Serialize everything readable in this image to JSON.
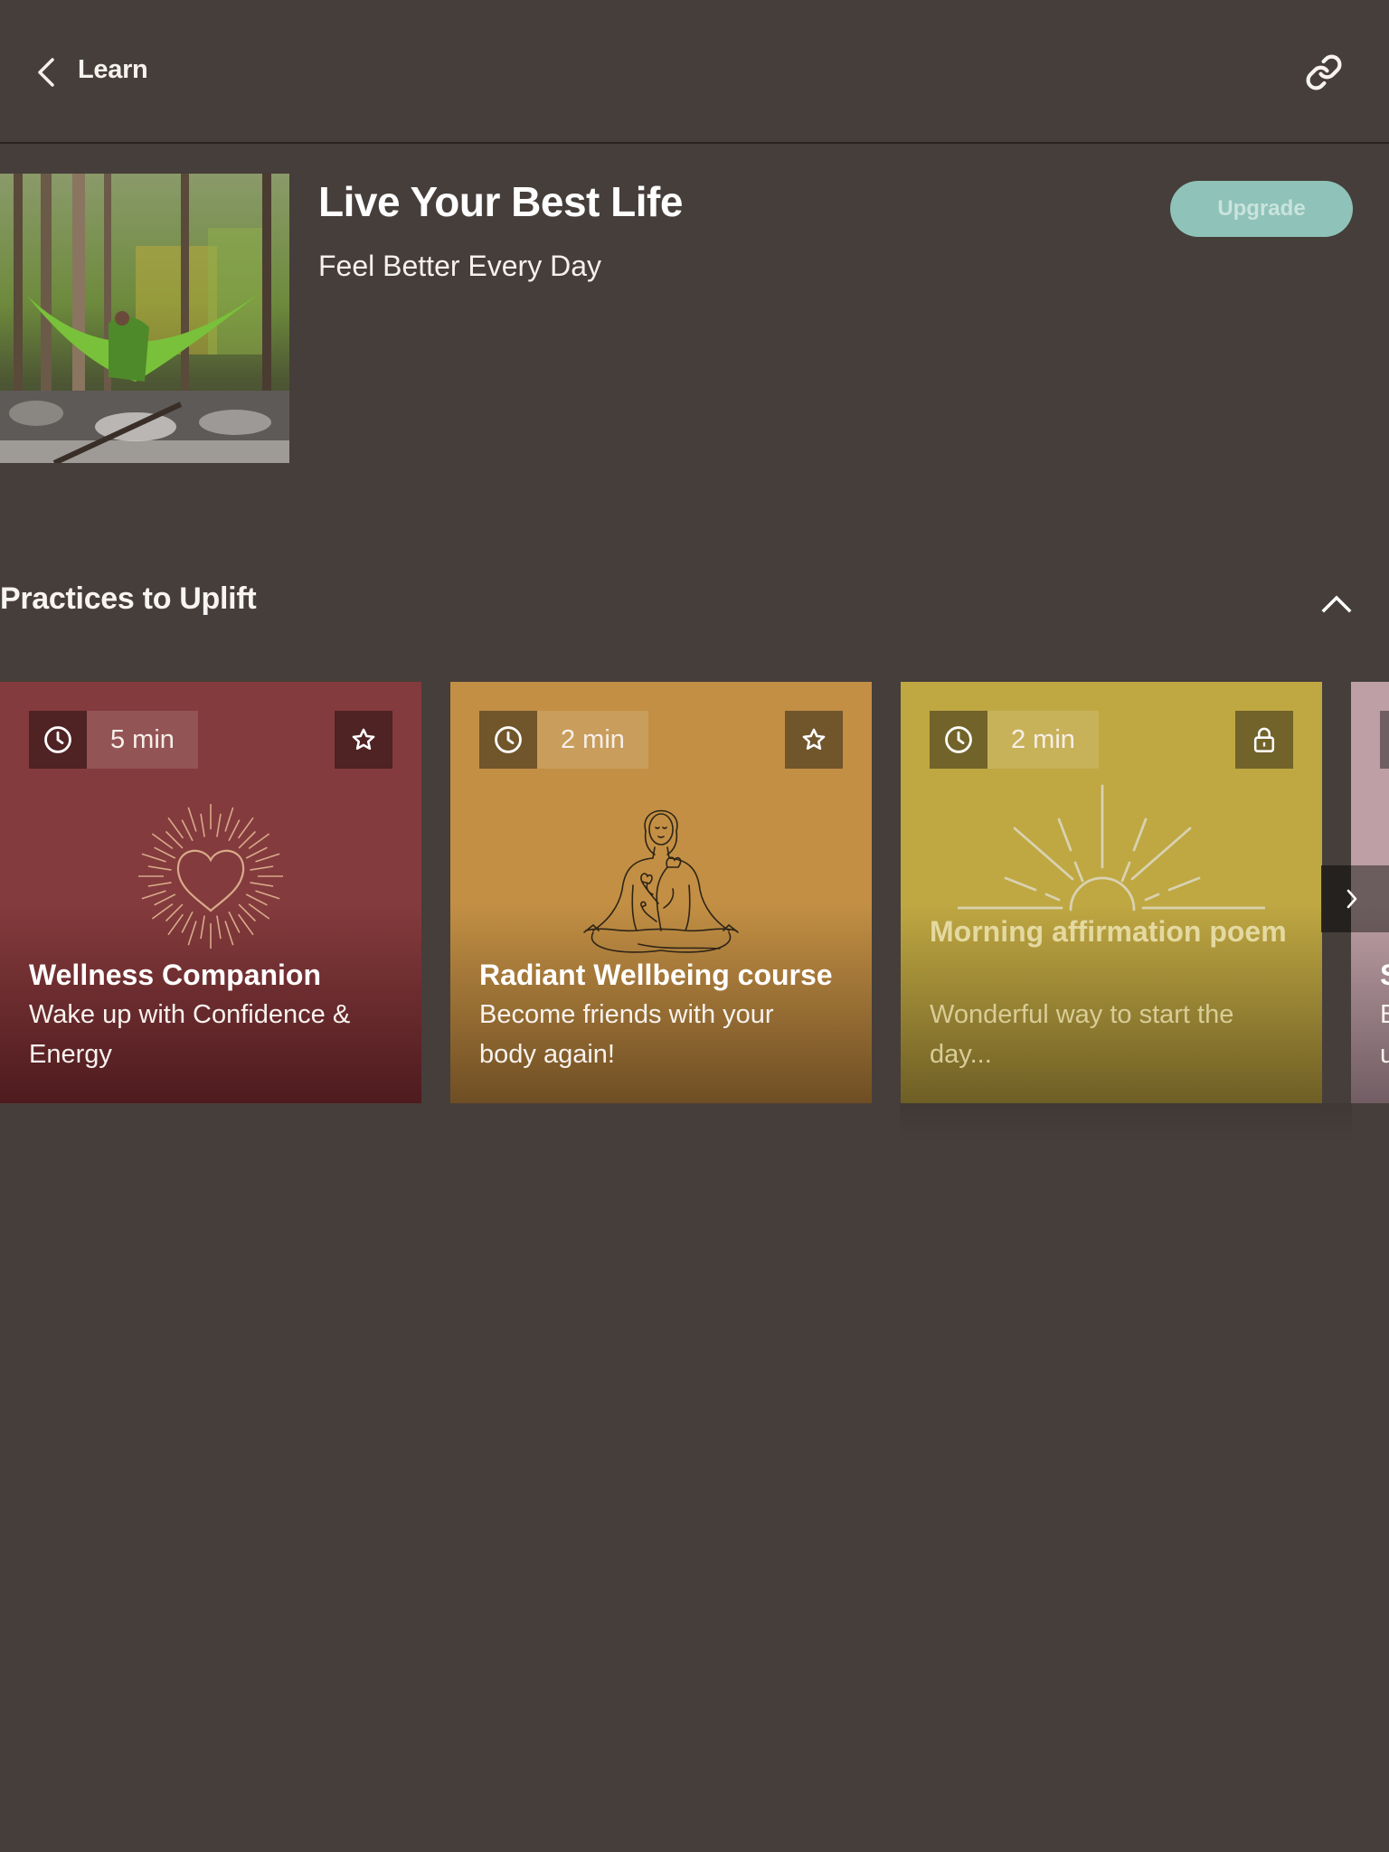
{
  "topbar": {
    "back_icon": "chevron-left-icon",
    "title": "Learn",
    "share_icon": "link-icon"
  },
  "hero": {
    "image_alt": "Person relaxing in a green hammock over a forest stream",
    "title": "Live Your Best Life",
    "subtitle": "Feel Better Every Day",
    "upgrade_label": "Upgrade",
    "upgrade_color": "#8fc2b8"
  },
  "section": {
    "title": "Practices to Uplift",
    "collapse_icon": "chevron-up-icon"
  },
  "cards": [
    {
      "duration": "5 min",
      "title": "Wellness Companion",
      "description": "Wake up with Confidence & Energy",
      "action_icon": "star-icon",
      "art": "radiant-heart",
      "locked": false,
      "color": "#843b3d"
    },
    {
      "duration": "2 min",
      "title": "Radiant Wellbeing course",
      "description": "Become friends with your body again!",
      "action_icon": "star-icon",
      "art": "meditating-woman",
      "locked": false,
      "color": "#c28f44"
    },
    {
      "duration": "2 min",
      "title": "Morning affirmation poem",
      "description": "Wonderful way to start the day...",
      "action_icon": "lock-icon",
      "art": "rising-sun",
      "locked": true,
      "color": "#bfa742"
    },
    {
      "duration": "",
      "title": "S",
      "description": "B u",
      "action_icon": "",
      "art": "",
      "locked": false,
      "color": "#bd9fa5"
    }
  ],
  "carousel": {
    "next_icon": "chevron-right-icon"
  }
}
